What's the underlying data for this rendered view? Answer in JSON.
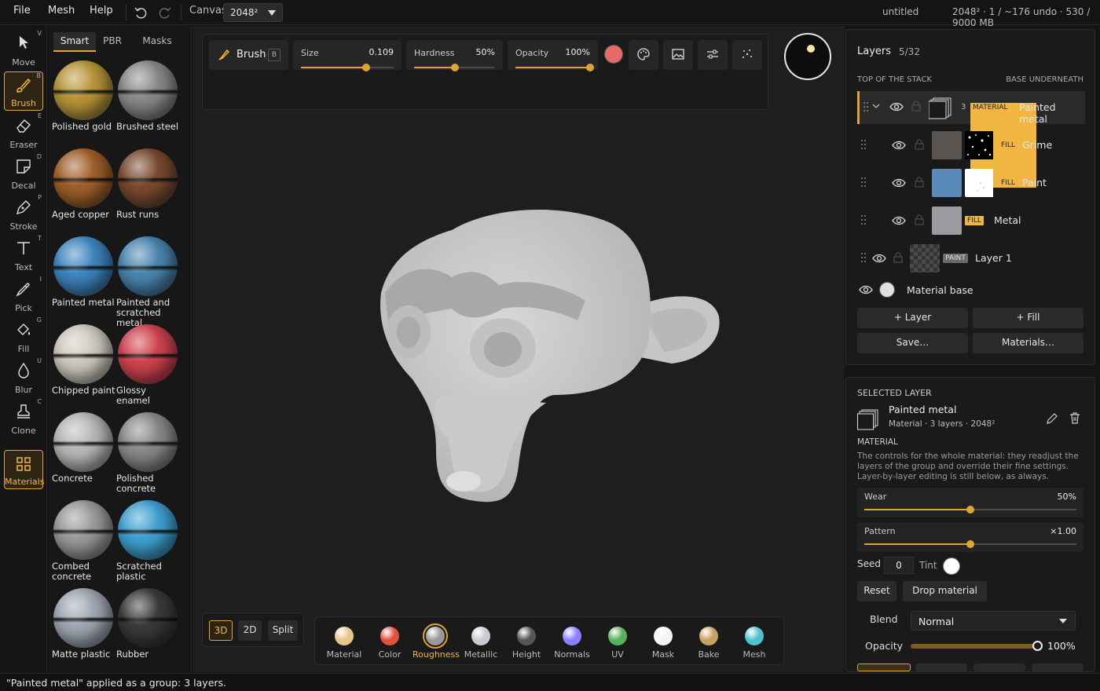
{
  "menu": {
    "file": "File",
    "mesh": "Mesh",
    "help": "Help",
    "canvas_label": "Canvas",
    "canvas_value": "2048²"
  },
  "document": {
    "name": "untitled",
    "stats": "2048² · 1 / ~176 undo · 530 / 9000 MB"
  },
  "tools": [
    {
      "label": "Move",
      "hotkey": "V"
    },
    {
      "label": "Brush",
      "hotkey": "B"
    },
    {
      "label": "Eraser",
      "hotkey": "E"
    },
    {
      "label": "Decal",
      "hotkey": "D"
    },
    {
      "label": "Stroke",
      "hotkey": "P"
    },
    {
      "label": "Text",
      "hotkey": "T"
    },
    {
      "label": "Pick",
      "hotkey": "I"
    },
    {
      "label": "Fill",
      "hotkey": "G"
    },
    {
      "label": "Blur",
      "hotkey": "U"
    },
    {
      "label": "Clone",
      "hotkey": "C"
    },
    {
      "label": "Materials",
      "hotkey": ""
    }
  ],
  "material_tabs": [
    "Smart",
    "PBR",
    "Masks"
  ],
  "materials": [
    {
      "name": "Polished gold",
      "color": "#b8963a"
    },
    {
      "name": "Brushed steel",
      "color": "#8a8a8a"
    },
    {
      "name": "Aged copper",
      "color": "#a0602a"
    },
    {
      "name": "Rust runs",
      "color": "#7a4a30"
    },
    {
      "name": "Painted metal",
      "color": "#3f86c0"
    },
    {
      "name": "Painted and scratched metal",
      "color": "#4a86b0"
    },
    {
      "name": "Chipped paint",
      "color": "#cfcac0"
    },
    {
      "name": "Glossy enamel",
      "color": "#d04450"
    },
    {
      "name": "Concrete",
      "color": "#b8b8b8"
    },
    {
      "name": "Polished concrete",
      "color": "#8a8a8a"
    },
    {
      "name": "Combed concrete",
      "color": "#9a9a9a"
    },
    {
      "name": "Scratched plastic",
      "color": "#3fa0d0"
    },
    {
      "name": "Matte plastic",
      "color": "#a0a8b4"
    },
    {
      "name": "Rubber",
      "color": "#3a3a3a"
    }
  ],
  "brush": {
    "label": "Brush",
    "hotkey": "B",
    "size_label": "Size",
    "size_value": "0.109",
    "size_frac": 0.7,
    "hardness_label": "Hardness",
    "hardness_value": "50%",
    "hardness_frac": 0.5,
    "opacity_label": "Opacity",
    "opacity_value": "100%",
    "opacity_frac": 1.0,
    "color": "#e86a6a"
  },
  "view_modes": [
    "3D",
    "2D",
    "Split"
  ],
  "channels": [
    {
      "label": "Material",
      "color": "#e8c48a"
    },
    {
      "label": "Color",
      "color": "#e0503e"
    },
    {
      "label": "Roughness",
      "color": "#9a9a9a",
      "active": true
    },
    {
      "label": "Metallic",
      "color": "#c8c8d0"
    },
    {
      "label": "Height",
      "color": "#555555"
    },
    {
      "label": "Normals",
      "color": "#8a80ff"
    },
    {
      "label": "UV",
      "color": "#5ab05a"
    },
    {
      "label": "Mask",
      "color": "#f4f4f4"
    },
    {
      "label": "Bake",
      "color": "#c8a060"
    },
    {
      "label": "Mesh",
      "color": "#50c0d0"
    }
  ],
  "layers": {
    "title": "Layers",
    "count": "5/32",
    "top_label": "TOP OF THE STACK",
    "base_label": "BASE UNDERNEATH",
    "group": {
      "index": "3",
      "tag": "MATERIAL",
      "name": "Painted metal"
    },
    "children": [
      {
        "tag": "FILL",
        "name": "Grime",
        "color": "#5a5450"
      },
      {
        "tag": "FILL",
        "name": "Paint",
        "color": "#5a8ab8"
      },
      {
        "tag": "FILL",
        "name": "Metal",
        "color": "#9a9aa0"
      }
    ],
    "paint_layer": {
      "tag": "PAINT",
      "name": "Layer 1"
    },
    "base": {
      "name": "Material base"
    },
    "buttons": {
      "add_layer": "+ Layer",
      "add_fill": "+ Fill",
      "save": "Save…",
      "materials": "Materials…"
    }
  },
  "selected": {
    "heading": "SELECTED LAYER",
    "name": "Painted metal",
    "meta": "Material · 3 layers · 2048²",
    "section": "MATERIAL",
    "description": "The controls for the whole material: they readjust the layers of the group and override their fine settings. Layer-by-layer editing is still below, as always.",
    "wear_label": "Wear",
    "wear_value": "50%",
    "wear_frac": 0.5,
    "pattern_label": "Pattern",
    "pattern_value": "×1.00",
    "pattern_frac": 0.5,
    "seed_label": "Seed",
    "seed_value": "0",
    "tint_label": "Tint",
    "reset": "Reset",
    "drop": "Drop material",
    "blend_label": "Blend",
    "blend_value": "Normal",
    "opacity_label": "Opacity",
    "opacity_value": "100%",
    "opacity_frac": 1.0
  },
  "status": "\"Painted metal\" applied as a group: 3 layers."
}
